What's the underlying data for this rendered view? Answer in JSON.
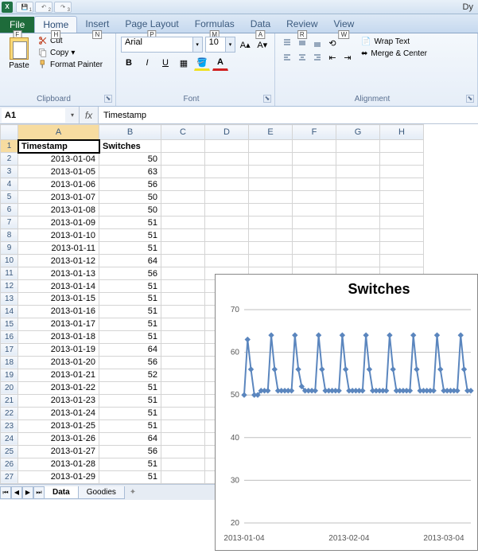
{
  "window": {
    "title": "Dy"
  },
  "qat": [
    {
      "icon": "save",
      "num": "1"
    },
    {
      "icon": "undo",
      "num": "2"
    },
    {
      "icon": "redo",
      "num": "3"
    }
  ],
  "tabs": {
    "file": "File",
    "items": [
      {
        "label": "Home",
        "hint": "H",
        "active": true
      },
      {
        "label": "Insert",
        "hint": "N"
      },
      {
        "label": "Page Layout",
        "hint": "P"
      },
      {
        "label": "Formulas",
        "hint": "M"
      },
      {
        "label": "Data",
        "hint": "A"
      },
      {
        "label": "Review",
        "hint": "R"
      },
      {
        "label": "View",
        "hint": "W"
      }
    ],
    "file_hint": "F"
  },
  "ribbon": {
    "clipboard": {
      "label": "Clipboard",
      "paste": "Paste",
      "cut": "Cut",
      "copy": "Copy",
      "format_painter": "Format Painter"
    },
    "font": {
      "label": "Font",
      "name": "Arial",
      "size": "10",
      "bold": "B",
      "italic": "I",
      "underline": "U"
    },
    "alignment": {
      "label": "Alignment",
      "wrap": "Wrap Text",
      "merge": "Merge & Center"
    }
  },
  "namebox": "A1",
  "formula": "Timestamp",
  "columns": [
    "A",
    "B",
    "C",
    "D",
    "E",
    "F",
    "G",
    "H"
  ],
  "col_widths": {
    "A": 102,
    "B": 78
  },
  "headers": {
    "a": "Timestamp",
    "b": "Switches"
  },
  "rows": [
    [
      "2013-01-04",
      50
    ],
    [
      "2013-01-05",
      63
    ],
    [
      "2013-01-06",
      56
    ],
    [
      "2013-01-07",
      50
    ],
    [
      "2013-01-08",
      50
    ],
    [
      "2013-01-09",
      51
    ],
    [
      "2013-01-10",
      51
    ],
    [
      "2013-01-11",
      51
    ],
    [
      "2013-01-12",
      64
    ],
    [
      "2013-01-13",
      56
    ],
    [
      "2013-01-14",
      51
    ],
    [
      "2013-01-15",
      51
    ],
    [
      "2013-01-16",
      51
    ],
    [
      "2013-01-17",
      51
    ],
    [
      "2013-01-18",
      51
    ],
    [
      "2013-01-19",
      64
    ],
    [
      "2013-01-20",
      56
    ],
    [
      "2013-01-21",
      52
    ],
    [
      "2013-01-22",
      51
    ],
    [
      "2013-01-23",
      51
    ],
    [
      "2013-01-24",
      51
    ],
    [
      "2013-01-25",
      51
    ],
    [
      "2013-01-26",
      64
    ],
    [
      "2013-01-27",
      56
    ],
    [
      "2013-01-28",
      51
    ],
    [
      "2013-01-29",
      51
    ]
  ],
  "chart_data": {
    "type": "line",
    "title": "Switches",
    "x_ticks": [
      "2013-01-04",
      "2013-02-04",
      "2013-03-04"
    ],
    "y_ticks": [
      20,
      30,
      40,
      50,
      60,
      70
    ],
    "ylim": [
      20,
      70
    ],
    "x": [
      "2013-01-04",
      "2013-01-05",
      "2013-01-06",
      "2013-01-07",
      "2013-01-08",
      "2013-01-09",
      "2013-01-10",
      "2013-01-11",
      "2013-01-12",
      "2013-01-13",
      "2013-01-14",
      "2013-01-15",
      "2013-01-16",
      "2013-01-17",
      "2013-01-18",
      "2013-01-19",
      "2013-01-20",
      "2013-01-21",
      "2013-01-22",
      "2013-01-23",
      "2013-01-24",
      "2013-01-25",
      "2013-01-26",
      "2013-01-27",
      "2013-01-28",
      "2013-01-29",
      "2013-01-30",
      "2013-01-31",
      "2013-02-01",
      "2013-02-02",
      "2013-02-03",
      "2013-02-04",
      "2013-02-05",
      "2013-02-06",
      "2013-02-07",
      "2013-02-08",
      "2013-02-09",
      "2013-02-10",
      "2013-02-11",
      "2013-02-12",
      "2013-02-13",
      "2013-02-14",
      "2013-02-15",
      "2013-02-16",
      "2013-02-17",
      "2013-02-18",
      "2013-02-19",
      "2013-02-20",
      "2013-02-21",
      "2013-02-22",
      "2013-02-23",
      "2013-02-24",
      "2013-02-25",
      "2013-02-26",
      "2013-02-27",
      "2013-02-28",
      "2013-03-01",
      "2013-03-02",
      "2013-03-03",
      "2013-03-04",
      "2013-03-05",
      "2013-03-06",
      "2013-03-07",
      "2013-03-08",
      "2013-03-09",
      "2013-03-10",
      "2013-03-11",
      "2013-03-12"
    ],
    "values": [
      50,
      63,
      56,
      50,
      50,
      51,
      51,
      51,
      64,
      56,
      51,
      51,
      51,
      51,
      51,
      64,
      56,
      52,
      51,
      51,
      51,
      51,
      64,
      56,
      51,
      51,
      51,
      51,
      51,
      64,
      56,
      51,
      51,
      51,
      51,
      51,
      64,
      56,
      51,
      51,
      51,
      51,
      51,
      64,
      56,
      51,
      51,
      51,
      51,
      51,
      64,
      56,
      51,
      51,
      51,
      51,
      51,
      64,
      56,
      51,
      51,
      51,
      51,
      51,
      64,
      56,
      51,
      51
    ],
    "color": "#5b86be"
  },
  "sheets": [
    {
      "name": "Data",
      "active": true
    },
    {
      "name": "Goodies",
      "active": false
    }
  ]
}
